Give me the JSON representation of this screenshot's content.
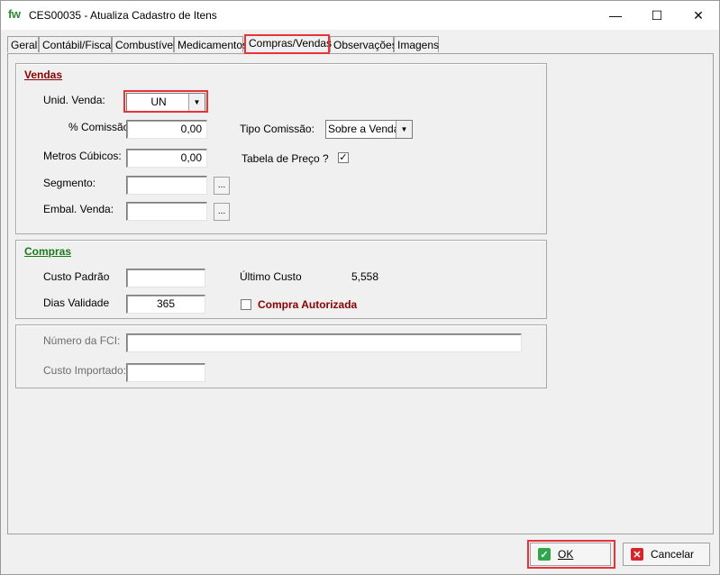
{
  "window": {
    "logo": "fw",
    "title": "CES00035 - Atualiza Cadastro de Itens",
    "controls": {
      "minimize": "—",
      "maximize": "☐",
      "close": "✕"
    }
  },
  "tabs": [
    {
      "label": "Geral"
    },
    {
      "label": "Contábil/Fiscal"
    },
    {
      "label": "Combustível"
    },
    {
      "label": "Medicamentos"
    },
    {
      "label": "Compras/Vendas"
    },
    {
      "label": "Observações"
    },
    {
      "label": "Imagens"
    }
  ],
  "vendas": {
    "title": "Vendas",
    "unid_venda_label": "Unid. Venda:",
    "unid_venda_value": "UN",
    "comissao_label": "% Comissão:",
    "comissao_value": "0,00",
    "tipo_comissao_label": "Tipo Comissão:",
    "tipo_comissao_value": "Sobre a Venda",
    "metros_cubicos_label": "Metros Cúbicos:",
    "metros_cubicos_value": "0,00",
    "tabela_preco_label": "Tabela de Preço ?",
    "tabela_preco_checked": "✓",
    "segmento_label": "Segmento:",
    "segmento_value": "",
    "embal_venda_label": "Embal. Venda:",
    "embal_venda_value": "",
    "ellipsis": "..."
  },
  "compras": {
    "title": "Compras",
    "custo_padrao_label": "Custo Padrão",
    "custo_padrao_value": "",
    "ultimo_custo_label": "Último Custo",
    "ultimo_custo_value": "5,558",
    "dias_validade_label": "Dias Validade",
    "dias_validade_value": "365",
    "compra_autorizada_label": "Compra Autorizada"
  },
  "fci": {
    "numero_label": "Número da FCI:",
    "numero_value": "",
    "custo_importado_label": "Custo Importado:",
    "custo_importado_value": ""
  },
  "buttons": {
    "ok_label": "OK",
    "ok_icon": "✓",
    "cancel_label": "Cancelar",
    "cancel_icon": "✕"
  },
  "colors": {
    "vendas_title": "#8b0000",
    "compras_title": "#1a7a1a",
    "compra_autorizada": "#8b0000",
    "highlight": "#e8333a",
    "ok_icon_bg": "#2ea84a",
    "cancel_icon_bg": "#d6262d"
  }
}
